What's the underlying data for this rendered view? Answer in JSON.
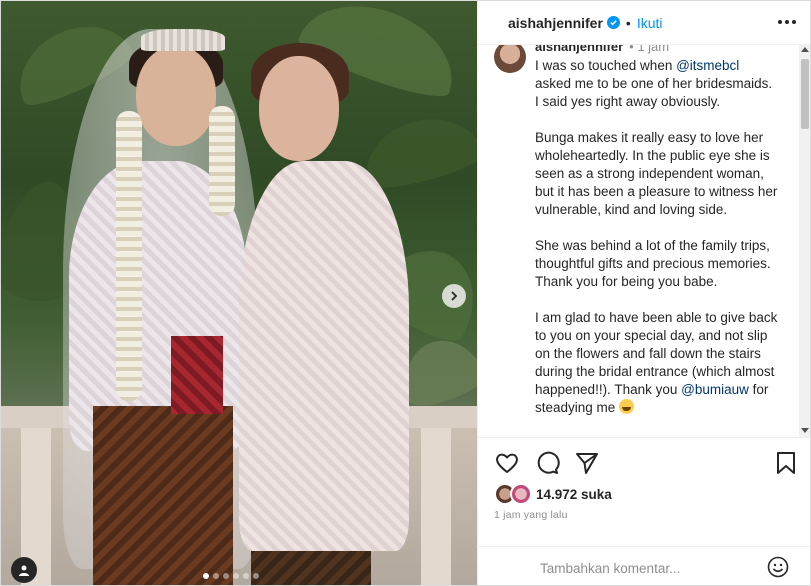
{
  "post": {
    "username": "aishahjennifer",
    "follow_label": "Ikuti",
    "separator": "•",
    "caption_time": "1 jam",
    "caption_paragraphs": [
      {
        "before": "I was so touched when ",
        "mention": "@itsmebcl",
        "after": " asked me to be one of her bridesmaids. I said yes right away obviously."
      },
      {
        "text": "Bunga makes it really easy to love her wholeheartedly. In the public eye she is seen as a strong independent woman, but it has been a pleasure to witness her vulnerable, kind and loving side."
      },
      {
        "text": "She was behind a lot of the family trips, thoughtful gifts and precious memories. Thank you for being you babe."
      },
      {
        "text": "I am glad to have been able to give back to you on your special day, and not slip on the flowers and fall down the stairs during the bridal entrance (which almost happened!!). Thank you "
      },
      {
        "mention": "@bumiauw",
        "after": " for steadying me"
      }
    ],
    "likes": "14.972 suka",
    "time_ago": "1 jam yang lalu",
    "comment_placeholder": "Tambahkan komentar...",
    "carousel": {
      "count": 6,
      "active_index": 0
    }
  },
  "icons": [
    "verified-badge-icon",
    "more-options-icon",
    "heart-icon",
    "comment-icon",
    "share-icon",
    "bookmark-icon",
    "emoji-icon",
    "next-arrow-icon",
    "tag-person-icon"
  ],
  "colors": {
    "accent": "#0095f6",
    "text": "#262626",
    "muted": "#8e8e8e",
    "mention": "#00376b"
  }
}
